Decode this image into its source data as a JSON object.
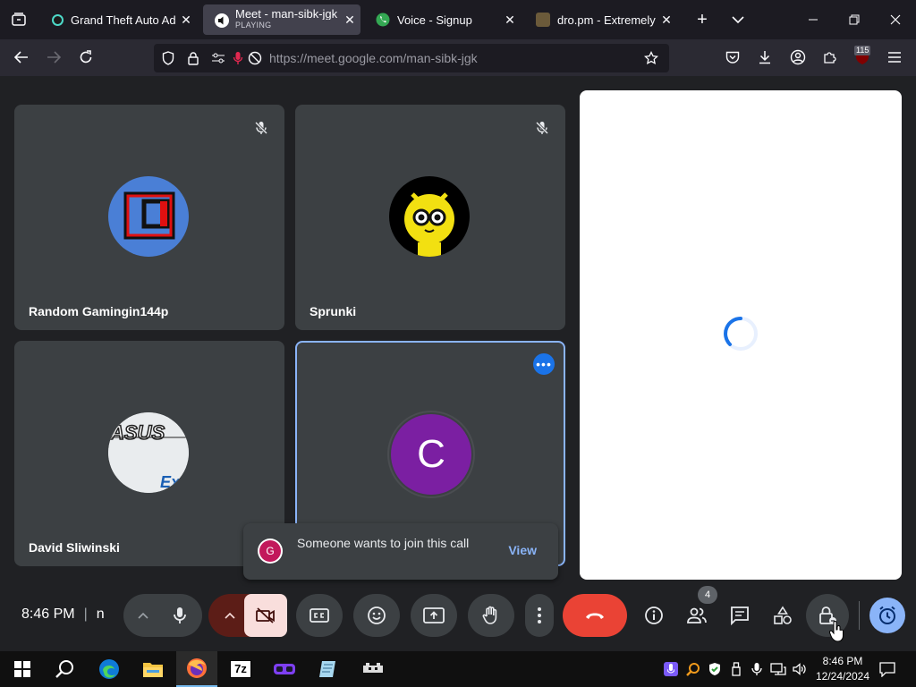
{
  "browser": {
    "tabs": [
      {
        "title": "Grand Theft Auto Adva",
        "sub": ""
      },
      {
        "title": "Meet - man-sibk-jgk",
        "sub": "PLAYING"
      },
      {
        "title": "Voice - Signup",
        "sub": ""
      },
      {
        "title": "dro.pm - Extremely Sh",
        "sub": ""
      }
    ],
    "url_host": "https://meet.google.com",
    "url_path": "/man-sibk-jgk",
    "extension_badge": "115"
  },
  "meet": {
    "participants": [
      {
        "name": "Random Gamingin144p",
        "muted": true
      },
      {
        "name": "Sprunki",
        "muted": true
      },
      {
        "name": "David Sliwinski",
        "muted": false
      },
      {
        "name": "",
        "avatar_letter": "C",
        "muted": false
      }
    ],
    "toast": {
      "avatar_letter": "G",
      "message": "Someone wants to join this call",
      "action": "View"
    },
    "clock": "8:46 PM",
    "meeting_code_prefix": "n",
    "people_count": "4"
  },
  "taskbar": {
    "time": "8:46 PM",
    "date": "12/24/2024"
  },
  "colors": {
    "end_call": "#ea4335",
    "accent": "#8ab4f8",
    "active_border": "#8ab4f8",
    "camera_off": "#f9dedc"
  }
}
